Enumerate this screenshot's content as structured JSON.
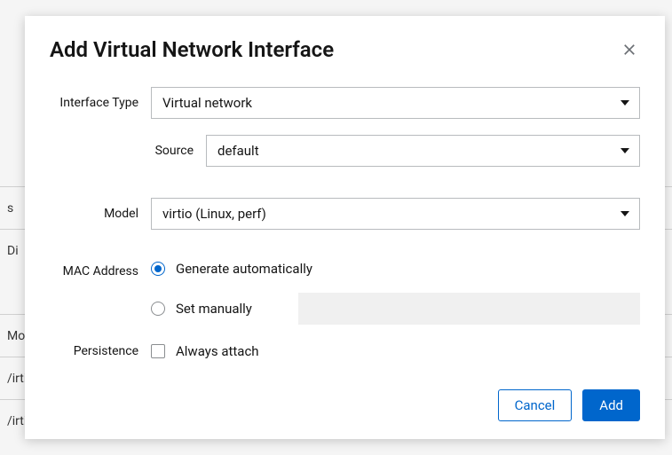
{
  "modal": {
    "title": "Add Virtual Network Interface",
    "fields": {
      "interfaceType": {
        "label": "Interface Type",
        "value": "Virtual network"
      },
      "source": {
        "label": "Source",
        "value": "default"
      },
      "model": {
        "label": "Model",
        "value": "virtio (Linux, perf)"
      },
      "macAddress": {
        "label": "MAC Address",
        "options": {
          "generate": "Generate automatically",
          "manual": "Set manually"
        },
        "selected": "generate",
        "manualValue": ""
      },
      "persistence": {
        "label": "Persistence",
        "checkboxLabel": "Always attach",
        "checked": false
      }
    },
    "buttons": {
      "cancel": "Cancel",
      "add": "Add"
    }
  },
  "background": {
    "rows": [
      "",
      "Di",
      "Mod",
      "/irti",
      "/irti"
    ]
  }
}
